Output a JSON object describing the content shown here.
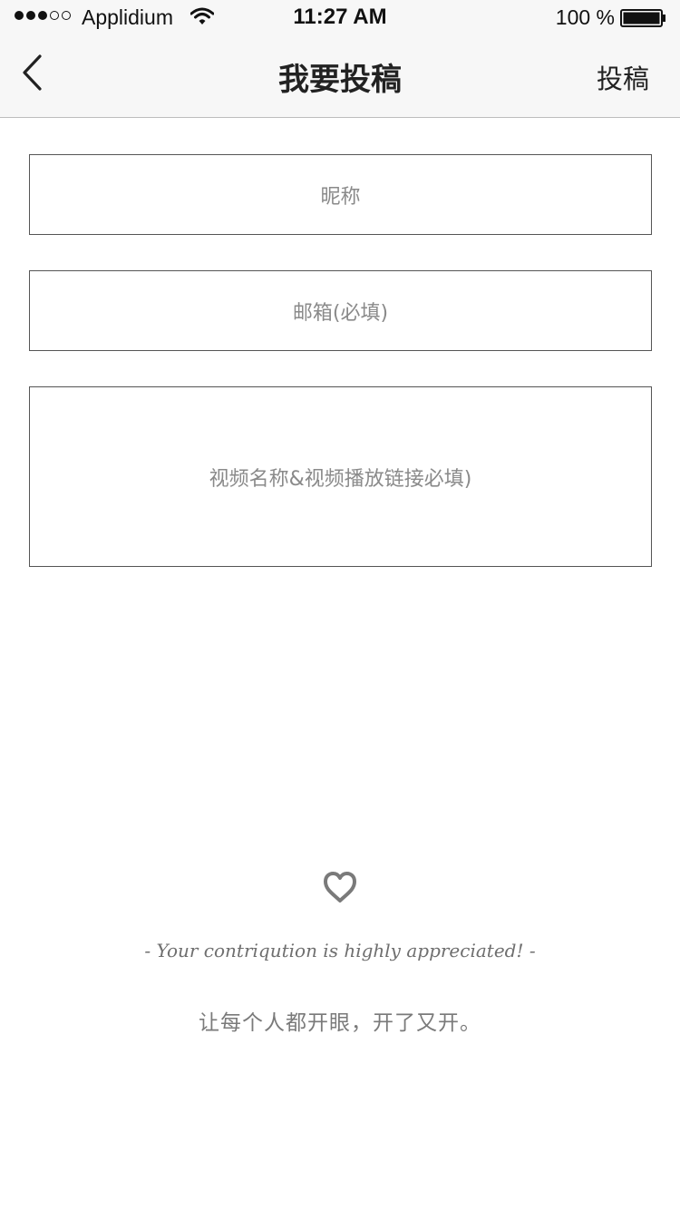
{
  "status_bar": {
    "signal_filled": 3,
    "signal_total": 5,
    "carrier": "Applidium",
    "time": "11:27 AM",
    "battery_text": "100 %",
    "battery_level": 1.0
  },
  "nav": {
    "back_icon": "chevron-left-icon",
    "title": "我要投稿",
    "submit_label": "投稿"
  },
  "form": {
    "nickname_placeholder": "昵称",
    "email_placeholder": "邮箱(必填)",
    "video_placeholder": "视频名称&视频播放链接必填)"
  },
  "footer": {
    "heart_icon": "heart-icon",
    "appreciation": "- Your contriqution is highly appreciated! -",
    "slogan": "让每个人都开眼，开了又开。"
  },
  "colors": {
    "nav_background": "#f7f7f7",
    "border": "#555555",
    "placeholder": "#8a8a8a",
    "heart": "#7a7a7a"
  }
}
